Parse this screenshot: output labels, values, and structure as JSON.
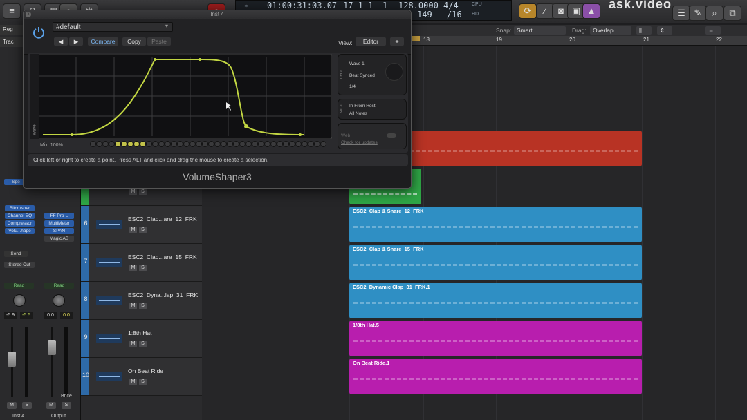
{
  "topbar": {
    "position": "01:00:31:03.07",
    "bars": "17  1  1",
    "beat": "1",
    "tempo": "128.0000",
    "signature": "4/4",
    "signature_sub": "/16",
    "key": "149",
    "cpu_label": "CPU",
    "hd_label": "HD",
    "brand": "ask.video"
  },
  "left_strip": {
    "regions": "Reg",
    "track": "Trac"
  },
  "control_bar": {
    "snap_label": "Snap:",
    "snap_value": "Smart",
    "drag_label": "Drag:",
    "drag_value": "Overlap"
  },
  "ruler": {
    "ticks": [
      "18",
      "19",
      "20",
      "21",
      "22"
    ]
  },
  "inspector": {
    "plugins_left": [
      "Bitcrusher",
      "Channel EQ",
      "Compressor",
      "Volu...hape"
    ],
    "plugins_right": [
      "FF Pro-L",
      "MultiMeter",
      "SPAN",
      "Magic AB"
    ],
    "send_label": "Send",
    "output": "Stereo Out",
    "read_left": "Read",
    "read_right": "Read",
    "vol_left": "-5.9",
    "peak_left": "-5.5",
    "vol_right": "0.0",
    "peak_right": "0.0",
    "bnce": "Bnce",
    "mute": "M",
    "solo": "S",
    "name_left": "Inst 4",
    "name_right": "Output",
    "spo": "Spo"
  },
  "plugin": {
    "window_title": "Inst 4",
    "preset": "#default",
    "compare": "Compare",
    "copy": "Copy",
    "paste": "Paste",
    "view_label": "View:",
    "view_value": "Editor",
    "mix_label": "Mix:",
    "mix_value": "100%",
    "wave_tag": "Wave",
    "lfo_tag": "LFO",
    "midi_tag": "MIDI",
    "lfo_wave": "Wave 1",
    "lfo_sync": "Beat Synced",
    "lfo_rate": "1/4",
    "midi_in": "In From Host",
    "midi_notes": "All Notes",
    "update_small": "Web",
    "check_updates": "Check for updates",
    "hint": "Click left or right to create a point. Press ALT and click and drag the mouse to create a selection.",
    "name": "VolumeShaper3"
  },
  "tracks": [
    {
      "num": "6",
      "name": "ESC2_Clap...are_12_FRK"
    },
    {
      "num": "7",
      "name": "ESC2_Clap...are_15_FRK"
    },
    {
      "num": "8",
      "name": "ESC2_Dyna...lap_31_FRK"
    },
    {
      "num": "9",
      "name": "1:8th Hat"
    },
    {
      "num": "10",
      "name": "On Beat Ride"
    }
  ],
  "track_mute": "M",
  "track_solo": "S",
  "regions": [
    {
      "label": "",
      "color": "#b83324"
    },
    {
      "label": "",
      "color": "#2fa646"
    },
    {
      "label": "ESC2_Clap & Snare_12_FRK",
      "color": "#2f8fc4"
    },
    {
      "label": "ESC2_Clap & Snare_15_FRK",
      "color": "#2f8fc4"
    },
    {
      "label": "ESC2_Dynamic Clap_31_FRK.1",
      "color": "#2f8fc4"
    },
    {
      "label": "1/8th Hat.5",
      "color": "#b81eae"
    },
    {
      "label": "On Beat Ride.1",
      "color": "#b81eae"
    }
  ]
}
